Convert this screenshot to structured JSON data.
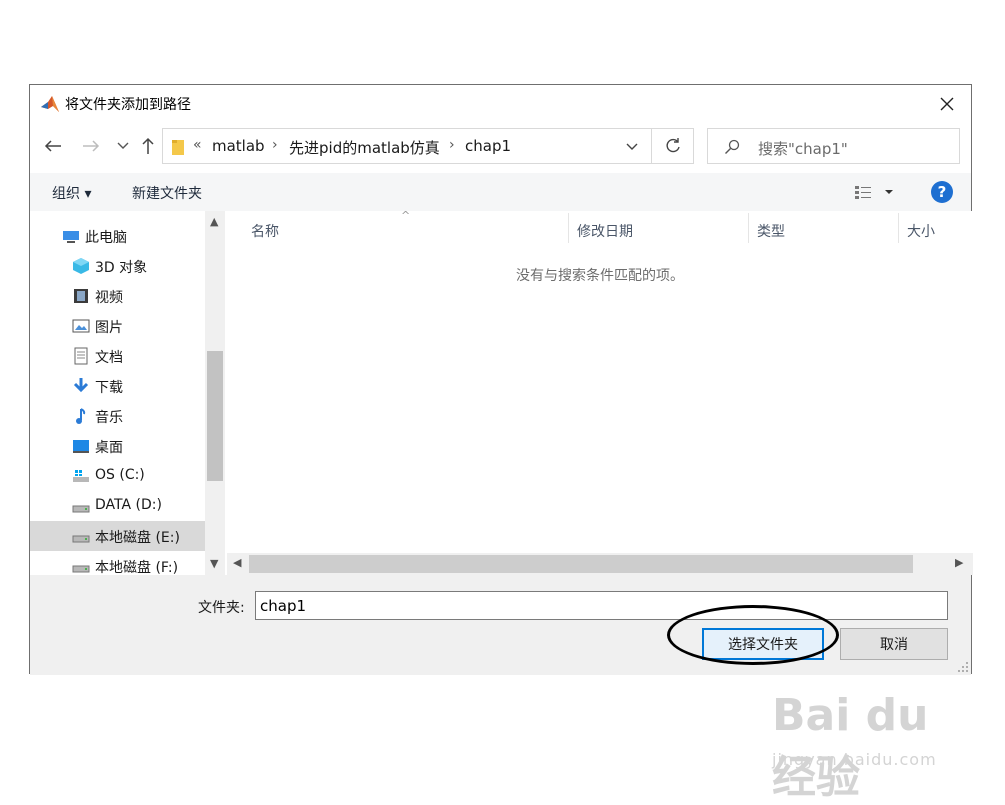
{
  "window": {
    "title": "将文件夹添加到路径"
  },
  "address_bar": {
    "overflow": "«",
    "crumbs": [
      "matlab",
      "先进pid的matlab仿真",
      "chap1"
    ]
  },
  "search": {
    "placeholder": "搜索\"chap1\""
  },
  "toolbar": {
    "organize": "组织 ▾",
    "new_folder": "新建文件夹",
    "help": "?"
  },
  "sidebar": {
    "items": [
      {
        "label": "此电脑",
        "icon": "pc-icon"
      },
      {
        "label": "3D 对象",
        "icon": "3d-objects-icon"
      },
      {
        "label": "视频",
        "icon": "video-icon"
      },
      {
        "label": "图片",
        "icon": "picture-icon"
      },
      {
        "label": "文档",
        "icon": "document-icon"
      },
      {
        "label": "下载",
        "icon": "download-icon"
      },
      {
        "label": "音乐",
        "icon": "music-icon"
      },
      {
        "label": "桌面",
        "icon": "desktop-icon"
      },
      {
        "label": "OS (C:)",
        "icon": "os-drive-icon"
      },
      {
        "label": "DATA (D:)",
        "icon": "drive-icon"
      },
      {
        "label": "本地磁盘 (E:)",
        "icon": "drive-icon",
        "selected": true
      },
      {
        "label": "本地磁盘 (F:)",
        "icon": "drive-icon"
      }
    ]
  },
  "columns": [
    "名称",
    "修改日期",
    "类型",
    "大小"
  ],
  "empty_message": "没有与搜索条件匹配的项。",
  "footer": {
    "folder_label": "文件夹:",
    "folder_value": "chap1",
    "select_button": "选择文件夹",
    "cancel_button": "取消"
  },
  "watermark": {
    "main": "Bai du 经验",
    "sub": "jingyan.baidu.com"
  },
  "colors": {
    "accent": "#0078d7",
    "help": "#1e6fd1",
    "selected": "#d9d9d9"
  }
}
